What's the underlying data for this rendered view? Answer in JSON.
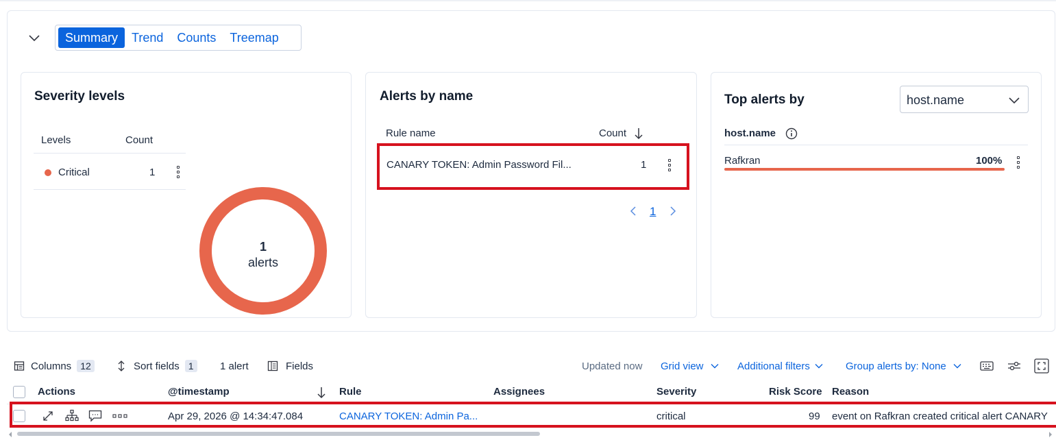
{
  "tabs": [
    {
      "label": "Summary",
      "active": true
    },
    {
      "label": "Trend",
      "active": false
    },
    {
      "label": "Counts",
      "active": false
    },
    {
      "label": "Treemap",
      "active": false
    }
  ],
  "severity_card": {
    "title": "Severity levels",
    "col_levels": "Levels",
    "col_count": "Count",
    "rows": [
      {
        "level": "Critical",
        "count": "1",
        "color": "#e7664c"
      }
    ],
    "donut": {
      "value": "1",
      "unit": "alerts",
      "color": "#e7664c"
    }
  },
  "alerts_card": {
    "title": "Alerts by name",
    "col_rule": "Rule name",
    "col_count": "Count",
    "rows": [
      {
        "rule": "CANARY TOKEN: Admin Password Fil...",
        "count": "1"
      }
    ],
    "page": "1"
  },
  "top_card": {
    "title": "Top alerts by",
    "select_value": "host.name",
    "field_label": "host.name",
    "rows": [
      {
        "name": "Rafkran",
        "percent": "100%",
        "fraction": 1.0
      }
    ]
  },
  "toolbar": {
    "columns_label": "Columns",
    "columns_count": "12",
    "sort_label": "Sort fields",
    "sort_count": "1",
    "alert_count": "1 alert",
    "fields_label": "Fields",
    "updated": "Updated now",
    "grid_view": "Grid view",
    "additional_filters": "Additional filters",
    "group_by": "Group alerts by: None"
  },
  "grid": {
    "headers": {
      "actions": "Actions",
      "timestamp": "@timestamp",
      "rule": "Rule",
      "assignees": "Assignees",
      "severity": "Severity",
      "risk_score": "Risk Score",
      "reason": "Reason"
    },
    "row": {
      "timestamp": "Apr 29, 2026 @ 14:34:47.084",
      "rule": "CANARY TOKEN: Admin Pa...",
      "assignees": "",
      "severity": "critical",
      "risk_score": "99",
      "reason": "event on Rafkran created critical alert CANARY"
    }
  },
  "colors": {
    "accent": "#0b64dd",
    "critical": "#e7664c",
    "highlight": "#d6121e"
  }
}
